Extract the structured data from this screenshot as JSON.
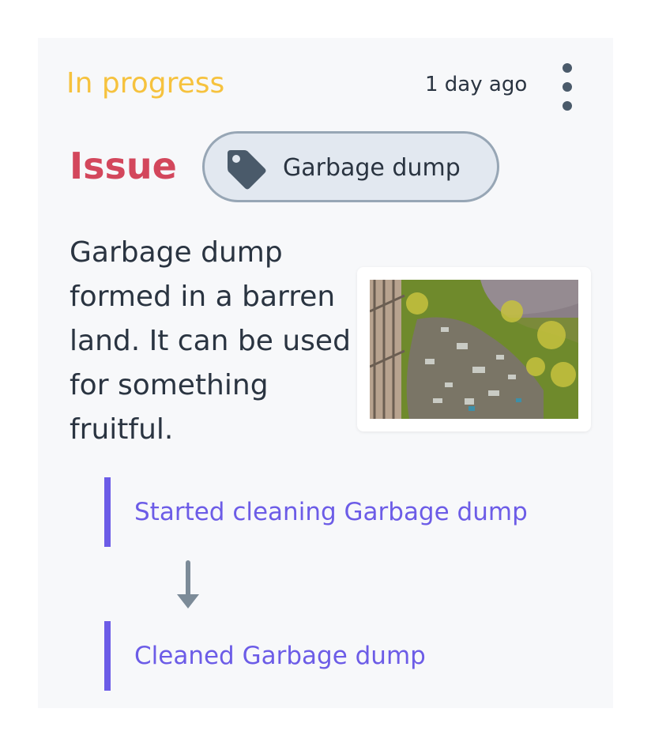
{
  "card": {
    "status": "In progress",
    "time_ago": "1 day ago",
    "menu_icon": "more-vertical-icon",
    "title": "Issue",
    "tag": {
      "icon": "tag-icon",
      "label": "Garbage dump"
    },
    "description": "Garbage dump formed in a barren land. It can be used for something fruitful."
  },
  "timeline": {
    "items": [
      {
        "label": "Started cleaning Garbage dump"
      },
      {
        "label": "Cleaned Garbage dump"
      }
    ],
    "connector_icon": "arrow-down-icon"
  },
  "colors": {
    "status": "#f6c23e",
    "title": "#d3475c",
    "accent": "#6c5ce7",
    "tag_bg": "#e2e8f0",
    "tag_border": "#97a6b5",
    "text": "#2a3441",
    "card_bg": "#f7f8fa"
  }
}
